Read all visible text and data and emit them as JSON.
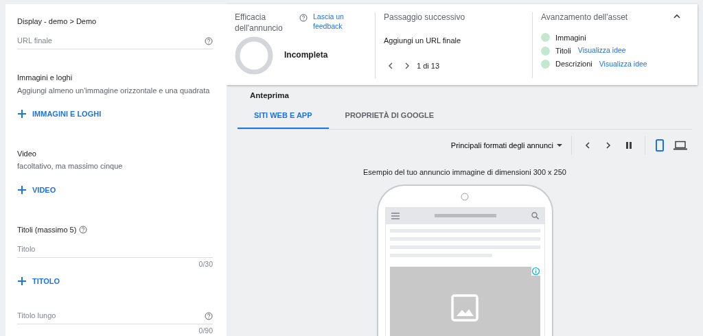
{
  "editor": {
    "breadcrumb": "Display - demo > Demo",
    "items": [
      {
        "kind": "field",
        "placeholder": "URL finale",
        "help": true
      },
      {
        "kind": "heading",
        "title": "Immagini e loghi",
        "subtitle": "Aggiungi almeno un'immagine orizzontale e una quadrata"
      },
      {
        "kind": "add",
        "label": "IMMAGINI E LOGHI"
      },
      {
        "kind": "heading",
        "title": "Video",
        "subtitle": "facoltativo, ma massimo cinque"
      },
      {
        "kind": "add",
        "label": "VIDEO"
      },
      {
        "kind": "heading",
        "title": "Titoli (massimo 5)",
        "help": true
      },
      {
        "kind": "field",
        "placeholder": "Titolo",
        "counter": "0/30"
      },
      {
        "kind": "add",
        "label": "TITOLO"
      },
      {
        "kind": "field",
        "placeholder": "Titolo lungo",
        "help": true,
        "counter": "0/90"
      }
    ]
  },
  "summary": {
    "strength": {
      "title": "Efficacia dell'annuncio",
      "link": "Lascia un feedback",
      "status": "Incompleta"
    },
    "next_step": {
      "title": "Passaggio successivo",
      "text": "Aggiungi un URL finale",
      "pager": "1 di 13"
    },
    "assets": {
      "title": "Avanzamento dell'asset",
      "items": [
        {
          "name": "Immagini"
        },
        {
          "name": "Titoli",
          "link": "Visualizza idee"
        },
        {
          "name": "Descrizioni",
          "link": "Visualizza idee"
        }
      ]
    }
  },
  "preview": {
    "title": "Anteprima",
    "tabs": [
      {
        "label": "SITI WEB E APP",
        "selected": true
      },
      {
        "label": "PROPRIETÀ DI GOOGLE",
        "selected": false
      }
    ],
    "format_dropdown": "Principali formati degli annunci",
    "devices": [
      {
        "kind": "mobile",
        "selected": true
      },
      {
        "kind": "desktop",
        "selected": false
      }
    ],
    "caption": "Esempio del tuo annuncio immagine di dimensioni 300 x 250"
  }
}
